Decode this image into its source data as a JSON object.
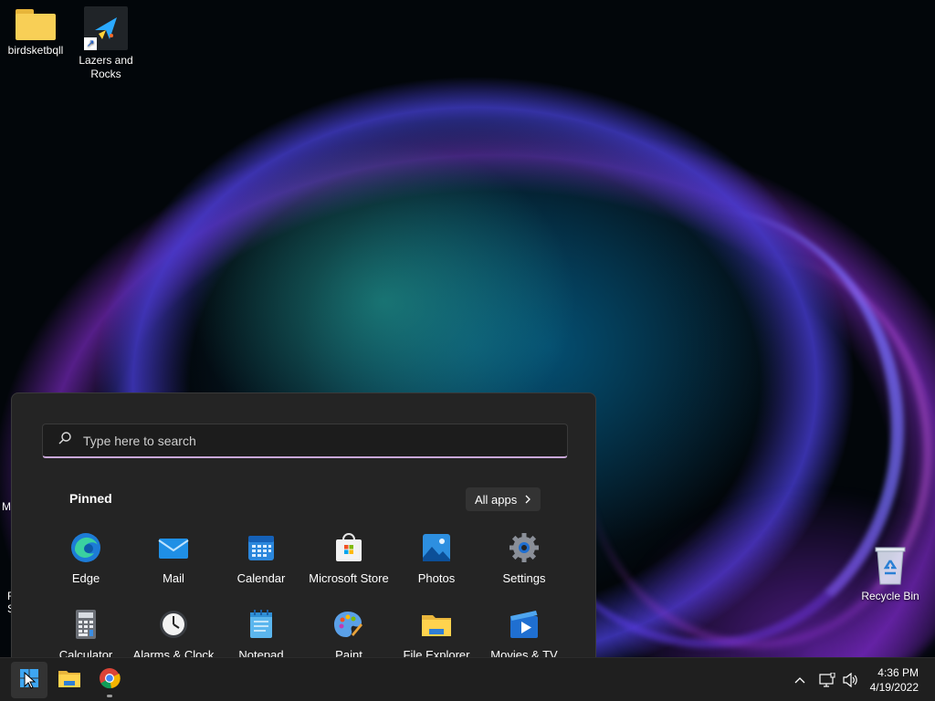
{
  "desktop": {
    "icons": [
      {
        "label": "birdsketbqll"
      },
      {
        "label_line1": "Lazers and",
        "label_line2": "Rocks"
      },
      {
        "label": "Recycle Bin"
      }
    ],
    "partial_labels": [
      "M",
      "F",
      "S"
    ]
  },
  "start_menu": {
    "search_placeholder": "Type here to search",
    "pinned_title": "Pinned",
    "all_apps_label": "All apps",
    "pinned_apps": [
      {
        "label": "Edge",
        "icon": "edge-icon"
      },
      {
        "label": "Mail",
        "icon": "mail-icon"
      },
      {
        "label": "Calendar",
        "icon": "calendar-icon"
      },
      {
        "label": "Microsoft Store",
        "icon": "store-icon"
      },
      {
        "label": "Photos",
        "icon": "photos-icon"
      },
      {
        "label": "Settings",
        "icon": "settings-icon"
      },
      {
        "label": "Calculator",
        "icon": "calculator-icon"
      },
      {
        "label": "Alarms & Clock",
        "icon": "clock-icon"
      },
      {
        "label": "Notepad",
        "icon": "notepad-icon"
      },
      {
        "label": "Paint",
        "icon": "paint-icon"
      },
      {
        "label": "File Explorer",
        "icon": "folder-icon"
      },
      {
        "label": "Movies & TV",
        "icon": "movies-icon"
      }
    ]
  },
  "taskbar": {
    "buttons": [
      "start-icon",
      "file-explorer-icon",
      "chrome-icon"
    ],
    "tray": [
      "chevron-up-icon",
      "network-icon",
      "volume-icon"
    ],
    "time": "4:36 PM",
    "date": "4/19/2022"
  },
  "colors": {
    "accent": "#c9a7d8",
    "menu_bg": "#242424",
    "taskbar_bg": "#1f1f1f"
  }
}
